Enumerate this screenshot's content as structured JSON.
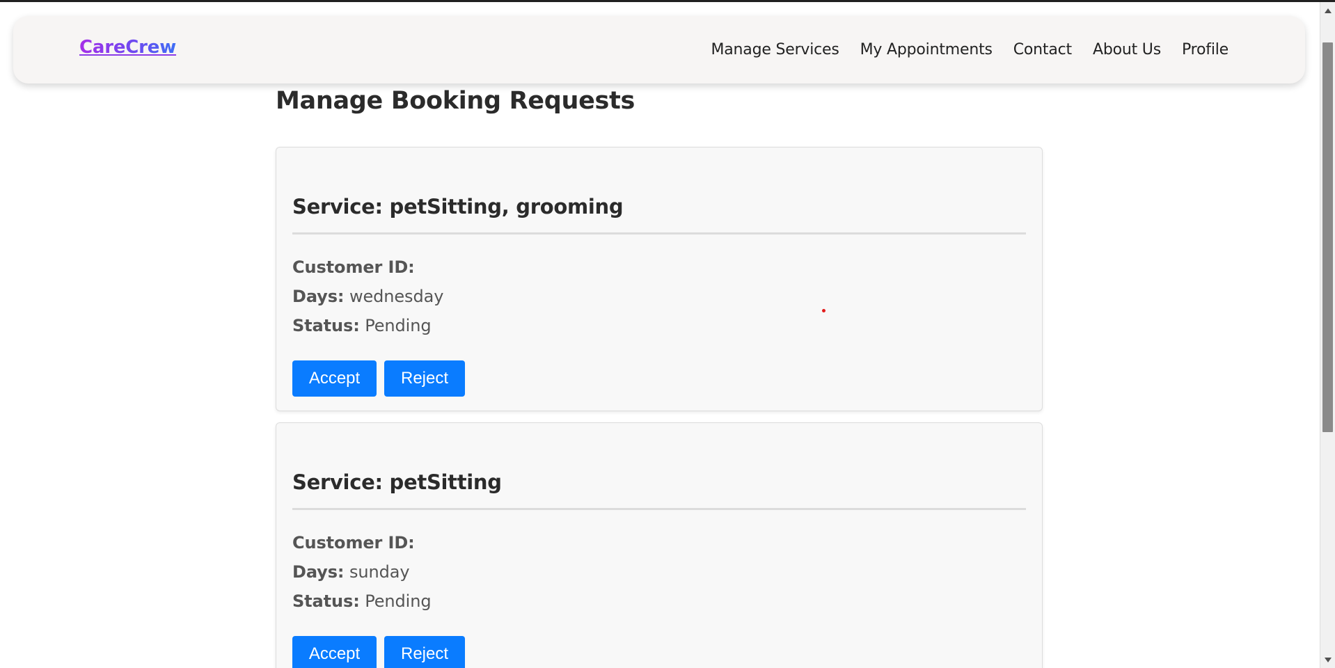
{
  "navbar": {
    "brand": "CareCrew",
    "links": [
      "Manage Services",
      "My Appointments",
      "Contact",
      "About Us",
      "Profile"
    ]
  },
  "page": {
    "title": "Manage Booking Requests"
  },
  "labels": {
    "customer_id": "Customer ID:",
    "days": "Days:",
    "status": "Status:",
    "accept": "Accept",
    "reject": "Reject"
  },
  "bookings": [
    {
      "service": "Service: petSitting, grooming",
      "customer_id": "",
      "days": "wednesday",
      "status": "Pending"
    },
    {
      "service": "Service: petSitting",
      "customer_id": "",
      "days": "sunday",
      "status": "Pending"
    }
  ],
  "colors": {
    "accent_button": "#0a7cff",
    "brand_gradient_start": "#a62fe8",
    "brand_gradient_end": "#3e6ef5",
    "marker_dot": "#e21b1b"
  },
  "icons": {
    "scroll_up": "scroll-up-arrow-icon",
    "scroll_down": "scroll-down-arrow-icon"
  }
}
